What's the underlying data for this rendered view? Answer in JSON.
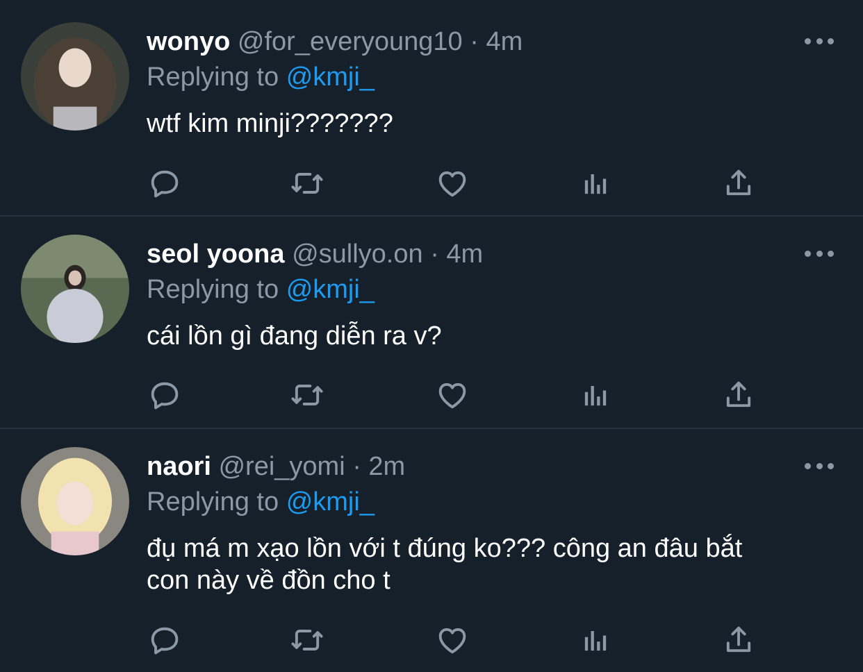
{
  "tweets": [
    {
      "name": "wonyo",
      "handle": "@for_everyoung10",
      "separator": "·",
      "time": "4m",
      "replying_prefix": "Replying to",
      "replying_to": "@kmji_",
      "text": "wtf kim minji???????"
    },
    {
      "name": "seol yoona",
      "handle": "@sullyo.on",
      "separator": "·",
      "time": "4m",
      "replying_prefix": "Replying to",
      "replying_to": "@kmji_",
      "text": "cái lồn gì đang diễn ra v?"
    },
    {
      "name": "naori",
      "handle": "@rei_yomi",
      "separator": "·",
      "time": "2m",
      "replying_prefix": "Replying to",
      "replying_to": "@kmji_",
      "text_line1": "đụ má m xạo lồn với t đúng ko??? công an đâu bắt",
      "text_line2": "con này về đồn cho t"
    }
  ],
  "icons": {
    "reply": "reply-icon",
    "retweet": "retweet-icon",
    "like": "heart-icon",
    "views": "analytics-icon",
    "share": "share-icon",
    "more": "more-icon"
  },
  "colors": {
    "background": "#15202b",
    "divider": "#253341",
    "secondary_text": "#8b98a5",
    "mention": "#1d9bf0",
    "primary_text": "#ffffff"
  }
}
